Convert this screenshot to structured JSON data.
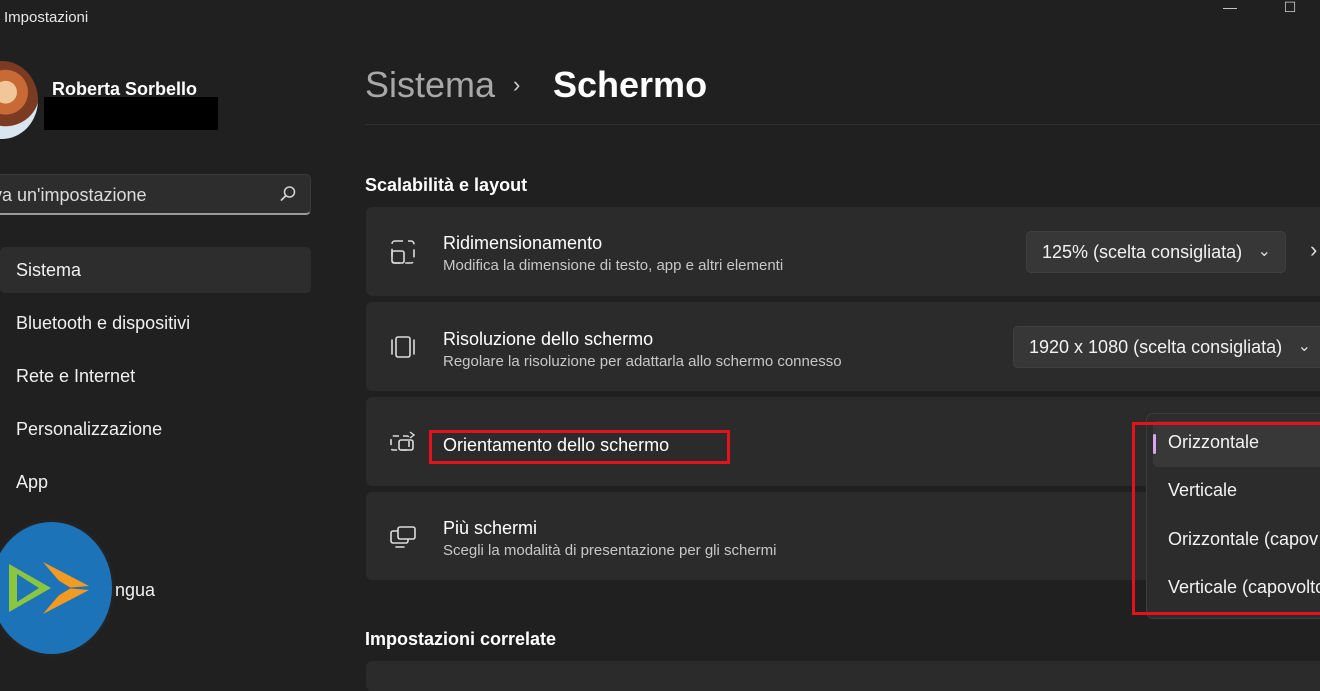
{
  "window": {
    "title": "Impostazioni",
    "minimize_glyph": "—",
    "maximize_glyph": "☐"
  },
  "user": {
    "name": "Roberta Sorbello"
  },
  "search": {
    "placeholder": "va un'impostazione"
  },
  "sidebar": {
    "items": [
      {
        "label": "Sistema",
        "active": true
      },
      {
        "label": "Bluetooth e dispositivi"
      },
      {
        "label": "Rete e Internet"
      },
      {
        "label": "Personalizzazione"
      },
      {
        "label": "App"
      }
    ],
    "partial_item": "ngua"
  },
  "breadcrumb": {
    "parent": "Sistema",
    "separator": "›",
    "current": "Schermo"
  },
  "sections": {
    "scaling_layout": "Scalabilità e layout",
    "related": "Impostazioni correlate"
  },
  "settings": {
    "scaling": {
      "title": "Ridimensionamento",
      "subtitle": "Modifica la dimensione di testo, app e altri elementi",
      "value": "125% (scelta consigliata)",
      "chevron": "⌄",
      "next_glyph": "›"
    },
    "resolution": {
      "title": "Risoluzione dello schermo",
      "subtitle": "Regolare la risoluzione per adattarla allo schermo connesso",
      "value": "1920 x 1080 (scelta consigliata)",
      "chevron": "⌄"
    },
    "orientation": {
      "title": "Orientamento dello schermo",
      "options": [
        "Orizzontale",
        "Verticale",
        "Orizzontale (capov",
        "Verticale (capovolto"
      ],
      "selected_index": 0
    },
    "multiple_displays": {
      "title": "Più schermi",
      "subtitle": "Scegli la modalità di presentazione per gli schermi"
    }
  },
  "colors": {
    "accent": "#d8a6ee",
    "highlight": "#e3121b",
    "background": "#202020",
    "card": "#2b2b2b"
  }
}
